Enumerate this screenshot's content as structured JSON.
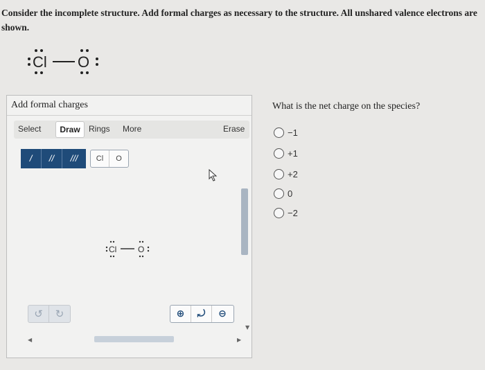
{
  "question": {
    "text": "Consider the incomplete structure. Add formal charges as necessary to the structure. All unshared valence electrons are shown."
  },
  "structure": {
    "atom1": "Cl",
    "atom2": "O"
  },
  "editor": {
    "title": "Add formal charges",
    "toolbar": {
      "select": "Select",
      "draw": "Draw",
      "rings": "Rings",
      "more": "More",
      "erase": "Erase"
    },
    "bonds": {
      "single": "/",
      "double": "//",
      "triple": "///"
    },
    "atoms": {
      "cl": "Cl",
      "o": "O"
    },
    "icons": {
      "undo": "undo-icon",
      "redo": "redo-icon",
      "zoom_in": "zoom-in-icon",
      "zoom_reset": "zoom-reset-icon",
      "zoom_out": "zoom-out-icon",
      "cursor": "cursor-icon"
    },
    "colors": {
      "accent": "#1f4b79"
    }
  },
  "net_charge": {
    "question": "What is the net charge on the species?",
    "options": [
      {
        "label": "−1"
      },
      {
        "label": "+1"
      },
      {
        "label": "+2"
      },
      {
        "label": "0"
      },
      {
        "label": "−2"
      }
    ]
  }
}
